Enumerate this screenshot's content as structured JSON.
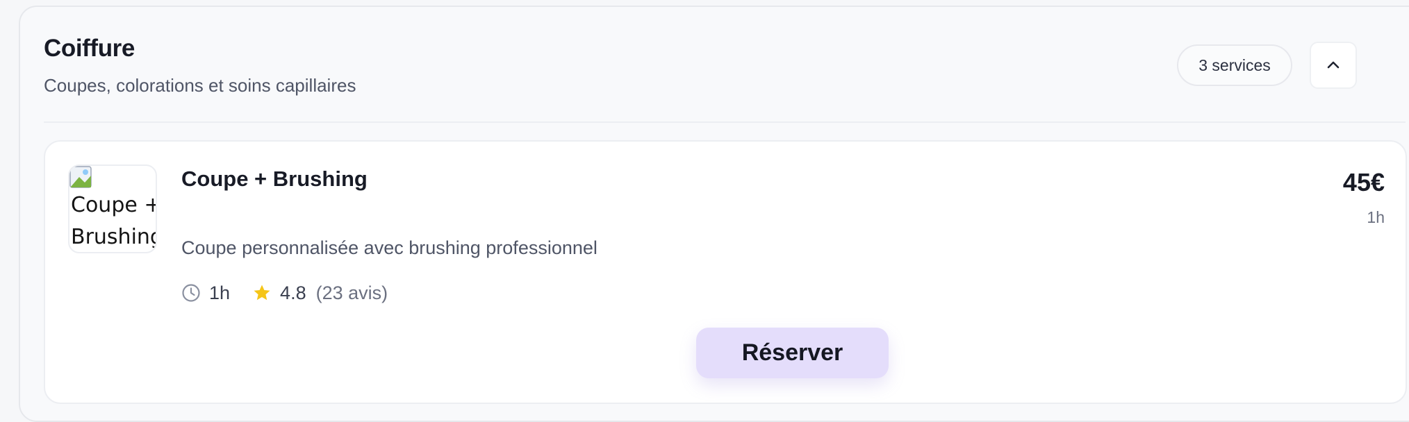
{
  "category": {
    "title": "Coiffure",
    "subtitle": "Coupes, colorations et soins capillaires",
    "count_label": "3 services",
    "collapse_icon": "chevron-up-icon"
  },
  "service": {
    "image_alt": "Coupe + Brushing",
    "name": "Coupe + Brushing",
    "description": "Coupe personnalisée avec brushing professionnel",
    "duration": "1h",
    "duration_icon": "clock-icon",
    "rating": "4.8",
    "rating_icon": "star-icon",
    "reviews": "(23 avis)",
    "price": "45€",
    "price_duration": "1h",
    "reserve_label": "Réserver"
  },
  "colors": {
    "accent_button": "#e4ddfb",
    "star": "#f5c518"
  }
}
